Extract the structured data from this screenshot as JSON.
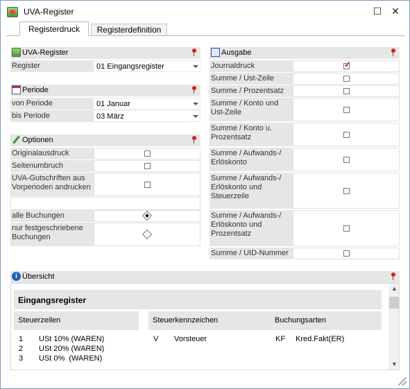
{
  "window": {
    "title": "UVA-Register"
  },
  "tabs": [
    {
      "label": "Registerdruck"
    },
    {
      "label": "Registerdefinition"
    }
  ],
  "uva": {
    "title": "UVA-Register",
    "register_label": "Register",
    "register_value": "01 Eingangsregister"
  },
  "periode": {
    "title": "Periode",
    "von_label": "von Periode",
    "von_value": "01 Januar",
    "bis_label": "bis Periode",
    "bis_value": "03 März"
  },
  "optionen": {
    "title": "Optionen",
    "items": [
      {
        "label": "Originalausdruck",
        "checked": false
      },
      {
        "label": "Seitenumbruch",
        "checked": false
      },
      {
        "label": "UVA-Gutschriften aus Vorperioden andrucken",
        "checked": false
      }
    ],
    "radios": [
      {
        "label": "alle Buchungen",
        "selected": true
      },
      {
        "label": "nur festgeschriebene Buchungen",
        "selected": false
      }
    ]
  },
  "ausgabe": {
    "title": "Ausgabe",
    "items": [
      {
        "label": "Journaldruck",
        "checked": true
      },
      {
        "label": "Summe / Ust-Zeile",
        "checked": false
      },
      {
        "label": "Summe / Prozentsatz",
        "checked": false
      },
      {
        "label": "Summe / Konto und Ust-Zeile",
        "checked": false
      },
      {
        "label": "Summe / Konto u. Prozentsatz",
        "checked": false
      },
      {
        "label": "Summe / Aufwands-/ Erlöskonto",
        "checked": false
      },
      {
        "label": "Summe / Aufwands-/ Erlöskonto und Steuerzeile",
        "checked": false
      },
      {
        "label": "Summe / Aufwands-/ Erlöskonto und Prozentsatz",
        "checked": false
      },
      {
        "label": "Summe / UID-Nummer",
        "checked": false
      }
    ]
  },
  "uebersicht": {
    "title": "Übersicht",
    "heading": "Eingangsregister",
    "col1": "Steuerzeilen",
    "col2": "Steuerkennzeichen",
    "col3": "Buchungsarten",
    "steuerzeilen": [
      {
        "nr": "1",
        "text": "USt 10% (WAREN)"
      },
      {
        "nr": "2",
        "text": "USt 20% (WAREN)"
      },
      {
        "nr": "3",
        "text": "USt 0%  (WAREN)"
      }
    ],
    "kennzeichen": [
      {
        "code": "V",
        "text": "Vorsteuer"
      }
    ],
    "buchungsarten": [
      {
        "code": "KF",
        "text": "Kred.Fakt(ER)"
      }
    ]
  }
}
